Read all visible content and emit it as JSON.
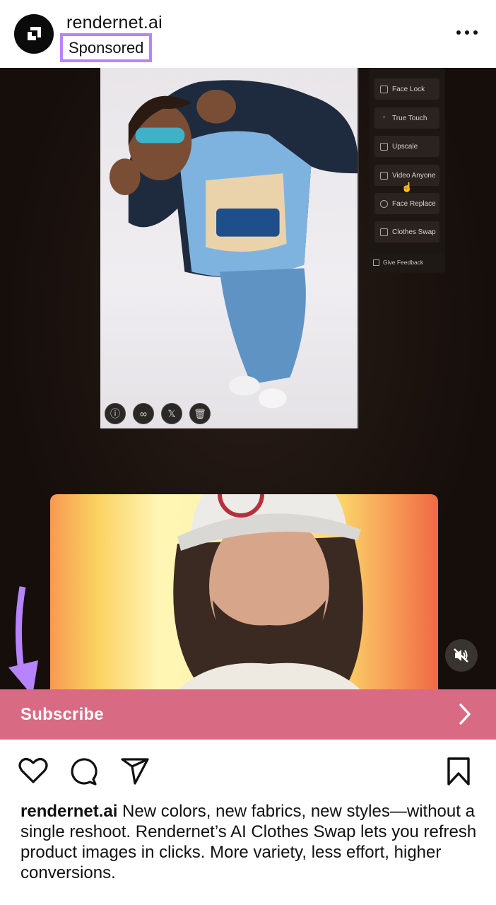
{
  "header": {
    "account_name": "rendernet.ai",
    "sponsored_label": "Sponsored",
    "avatar_icon": "rendernet-logo-icon",
    "more_icon": "more-horizontal-icon"
  },
  "media": {
    "image_actions": [
      {
        "icon": "info-icon",
        "glyph": "ⓘ"
      },
      {
        "icon": "link-icon",
        "glyph": "∞"
      },
      {
        "icon": "x-icon",
        "glyph": "𝕏"
      },
      {
        "icon": "trash-icon",
        "glyph": "🗑"
      }
    ],
    "tools": [
      {
        "label": "Face Lock",
        "icon": "face-lock-icon"
      },
      {
        "label": "True Touch",
        "icon": "sparkle-icon"
      },
      {
        "label": "Upscale",
        "icon": "upscale-icon"
      },
      {
        "label": "Video Anyone",
        "icon": "video-icon"
      },
      {
        "label": "Face Replace",
        "icon": "smile-icon"
      },
      {
        "label": "Clothes Swap",
        "icon": "shirt-icon"
      }
    ],
    "feedback_label": "Give Feedback",
    "mute_icon": "muted-speaker-icon"
  },
  "cta": {
    "label": "Subscribe",
    "icon": "chevron-right-icon",
    "color": "#d96a83"
  },
  "annotation": {
    "arrow_color": "#b784ff",
    "highlight_color": "#b784ff"
  },
  "actions": {
    "like_icon": "heart-icon",
    "comment_icon": "comment-icon",
    "share_icon": "send-icon",
    "save_icon": "bookmark-icon"
  },
  "caption": {
    "username": "rendernet.ai",
    "text": " New colors, new fabrics, new styles—without a single reshoot. Rendernet’s AI Clothes Swap lets you refresh product images in clicks. More variety, less effort, higher conversions."
  }
}
